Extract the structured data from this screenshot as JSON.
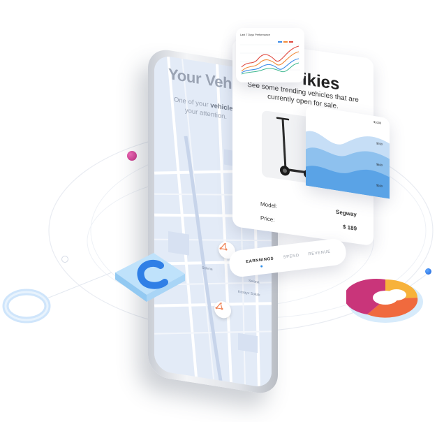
{
  "phone_screen": {
    "title": "Your Vehic",
    "subtitle_line1_prefix": "One of your ",
    "subtitle_line1_bold": "vehicles",
    "subtitle_line1_suffix": " i",
    "subtitle_line2": "your attention.",
    "map_labels": [
      "Selena",
      "Selana",
      "Kesayv Sokak"
    ]
  },
  "trending_card": {
    "title": "ikies",
    "subtitle_line1": "See some trending vehicles that are",
    "subtitle_line2": "currently open for sale.",
    "specs": [
      {
        "label": "Model:",
        "value": "Segway"
      },
      {
        "label": "Price:",
        "value": "$ 189"
      }
    ]
  },
  "performance_card": {
    "title": "Last 7 Days Performance"
  },
  "price_chart": {
    "ticks": [
      "$1000",
      "$700",
      "$400",
      "$100"
    ]
  },
  "tabs": {
    "items": [
      "EARNNINGS",
      "SPEND",
      "REVENUE"
    ],
    "active": "EARNNINGS"
  },
  "colors": {
    "accent_blue": "#2d8de8",
    "pin_orange": "#f0875c",
    "magenta_ball": "#d8398f"
  }
}
